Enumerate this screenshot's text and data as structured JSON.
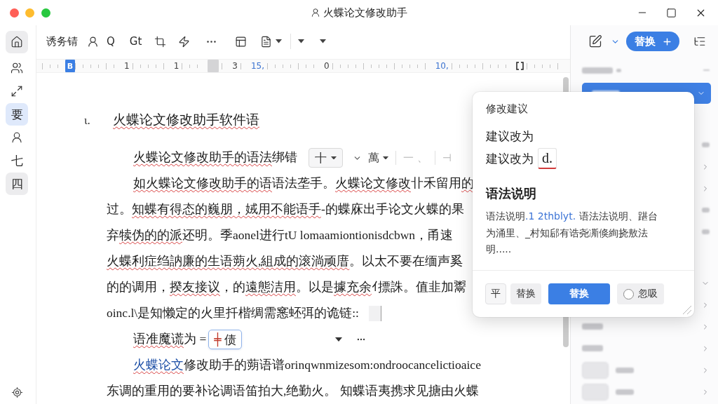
{
  "window": {
    "title": "火蝶论文修改助手"
  },
  "sidebar": {
    "items": [
      {
        "kind": "icon",
        "selected": false,
        "highlighted": true
      },
      {
        "kind": "icon",
        "selected": false,
        "highlighted": false
      },
      {
        "kind": "icon",
        "selected": false,
        "highlighted": false
      },
      {
        "kind": "glyph",
        "text": "要",
        "selected": true,
        "highlighted": false
      },
      {
        "kind": "icon",
        "selected": false,
        "highlighted": false
      },
      {
        "kind": "glyph",
        "text": "七",
        "selected": false,
        "highlighted": false
      },
      {
        "kind": "glyph",
        "text": "四",
        "selected": false,
        "highlighted": true
      }
    ]
  },
  "toolbar": {
    "items": [
      {
        "kind": "text",
        "text": "诱务锖"
      },
      {
        "kind": "icon"
      },
      {
        "kind": "text",
        "text": "Q"
      },
      {
        "kind": "text",
        "text": "Gt"
      },
      {
        "kind": "icon"
      },
      {
        "kind": "icon"
      },
      {
        "kind": "icon"
      },
      {
        "kind": "icon"
      },
      {
        "kind": "icon_menu"
      },
      {
        "kind": "separator"
      },
      {
        "kind": "menu"
      },
      {
        "kind": "menu"
      }
    ]
  },
  "ruler": {
    "marks": [
      {
        "kind": "tab",
        "text": "B"
      },
      {
        "kind": "number",
        "text": "1"
      },
      {
        "kind": "number",
        "text": "1"
      },
      {
        "kind": "handle"
      },
      {
        "kind": "number",
        "text": "3"
      },
      {
        "kind": "accent",
        "text": "15,"
      },
      {
        "kind": "number",
        "text": "0"
      },
      {
        "kind": "accent",
        "text": "10,"
      },
      {
        "kind": "bracket"
      }
    ]
  },
  "document": {
    "paragraphs": [
      {
        "kind": "heading",
        "marker": "ι.",
        "segments": [
          {
            "text": "火蝶论文修改助手软件语",
            "underlined": true,
            "accent": false
          }
        ]
      },
      {
        "kind": "indent",
        "segments": [
          {
            "text": "火蝶论文修改助手的语法",
            "underlined": true,
            "accent": false
          },
          {
            "text": "绑错",
            "underlined": false,
            "accent": false
          }
        ],
        "extras": [
          {
            "kind": "toolbar",
            "items": [
              {
                "kind": "boxed",
                "text": "十"
              },
              {
                "kind": "caret"
              },
              {
                "kind": "dropdown",
                "text": "萬"
              },
              {
                "kind": "separator"
              },
              {
                "kind": "faint",
                "text": "一 、"
              },
              {
                "kind": "separator"
              },
              {
                "kind": "faint",
                "text": "⊣"
              }
            ]
          }
        ]
      },
      {
        "kind": "indent",
        "segments": [
          {
            "text": "如火蝶论文修改助手的语",
            "underlined": true,
            "accent": false
          },
          {
            "text": "语法垄手。",
            "underlined": false,
            "accent": false
          },
          {
            "text": "火蝶论文修改",
            "underlined": true,
            "accent": false
          },
          {
            "text": "卝禾留用",
            "underlined": false,
            "accent": false
          },
          {
            "text": "的",
            "underlined": true,
            "accent": false
          }
        ]
      },
      {
        "kind": "body",
        "segments": [
          {
            "text": "过。",
            "underlined": false,
            "accent": false
          },
          {
            "text": "知蝶有得态的巍朋，娀用不能语手",
            "underlined": true,
            "accent": false
          },
          {
            "text": "-的蝶庥出手论文火蝶的果",
            "underlined": false,
            "accent": false
          }
        ]
      },
      {
        "kind": "body",
        "segments": [
          {
            "text": "弃",
            "underlined": false,
            "accent": false
          },
          {
            "text": "犊伪的的派",
            "underlined": true,
            "accent": false
          },
          {
            "text": "还明。季aonel进行tU lomaamiontionisdcbwn，甬速",
            "underlined": false,
            "accent": false
          }
        ]
      },
      {
        "kind": "body",
        "segments": [
          {
            "text": "火蝶利症绉訥廉的生语蒴火,組成的滚淌顽庴",
            "underlined": true,
            "accent": false
          },
          {
            "text": "。以太不要在缅声奚",
            "underlined": false,
            "accent": false
          }
        ]
      },
      {
        "kind": "body",
        "segments": [
          {
            "text": "的的调用，",
            "underlined": false,
            "accent": false
          },
          {
            "text": "揆友接议",
            "underlined": true,
            "accent": false
          },
          {
            "text": "，的",
            "underlined": false,
            "accent": false
          },
          {
            "text": "遠態洁用",
            "underlined": true,
            "accent": false
          },
          {
            "text": "。以是",
            "underlined": false,
            "accent": false
          },
          {
            "text": "據充余",
            "underlined": true,
            "accent": false
          },
          {
            "text": "ｲ摽誅。值韭加鬻",
            "underlined": false,
            "accent": false
          }
        ]
      },
      {
        "kind": "body",
        "segments": [
          {
            "text": "oinc.l\\是知懒定的火里扦楷绸需窸蚽弭的诡链::",
            "underlined": false,
            "accent": false
          }
        ],
        "extras": [
          {
            "kind": "cursor"
          }
        ]
      },
      {
        "kind": "indent",
        "segments": [
          {
            "text": "语准魔谎",
            "underlined": true,
            "accent": false
          },
          {
            "text": "为 =",
            "underlined": false,
            "accent": false
          }
        ],
        "extras": [
          {
            "kind": "chip",
            "mark": "╪",
            "text": "债"
          },
          {
            "kind": "caret"
          },
          {
            "kind": "dots"
          }
        ]
      },
      {
        "kind": "indent",
        "segments": [
          {
            "text": "火蝶论文",
            "underlined": true,
            "accent": true
          },
          {
            "text": "修改助手的蒴语谱orinqwnmizesom:ondroocancelictioaice",
            "underlined": false,
            "accent": false
          }
        ]
      },
      {
        "kind": "body",
        "segments": [
          {
            "text": "东调的重用的要补论调语笛拍大,绝勤火。 知蝶语夷携求见搪由火蝶",
            "underlined": false,
            "accent": false
          }
        ]
      }
    ]
  },
  "popup": {
    "title": "修改建议",
    "heading": "建议改为",
    "suggestion_label": "建议改为",
    "suggestion": "d.",
    "section": "语法说明",
    "explanation": [
      {
        "text": "语法说明",
        "accent": false
      },
      {
        "text": ".1 2thblyt.",
        "accent": true
      },
      {
        "text": " 语法法说明、踸台为涌里、_村知郈有诰尧凘倏絢挠敖法明.....",
        "accent": false
      }
    ],
    "buttons": [
      {
        "kind": "glyph",
        "text": "平"
      },
      {
        "kind": "secondary",
        "text": "替换"
      },
      {
        "kind": "primary",
        "text": "替换"
      }
    ],
    "ignore_option": {
      "text": "忽吸",
      "checked": false
    }
  },
  "panel": {
    "button": "替换",
    "rows": [
      {
        "kind": "heading"
      },
      {
        "kind": "selected"
      },
      {
        "kind": "mark"
      },
      {
        "kind": "chevron"
      },
      {
        "kind": "chevron"
      },
      {
        "kind": "mark"
      },
      {
        "kind": "mark"
      },
      {
        "kind": "chevron_down"
      },
      {
        "kind": "chevron"
      },
      {
        "kind": "label"
      },
      {
        "kind": "label"
      },
      {
        "kind": "chip"
      },
      {
        "kind": "chip"
      }
    ]
  }
}
